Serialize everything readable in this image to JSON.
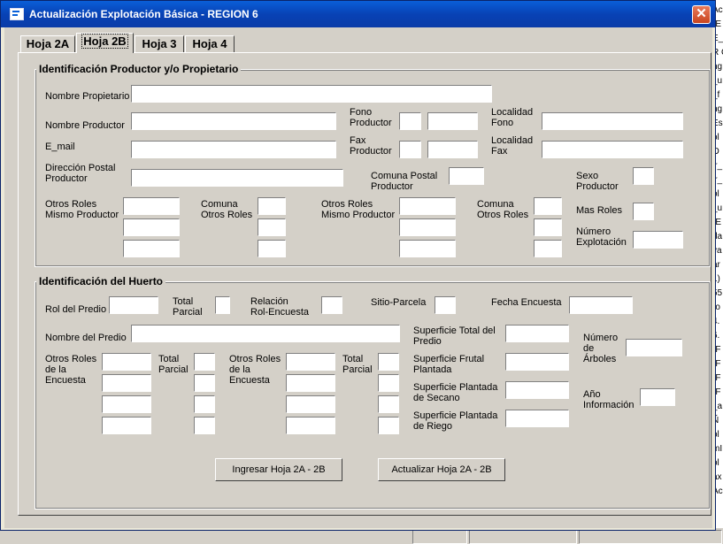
{
  "window": {
    "title": "Actualización Explotación Básica - REGION 6",
    "close": "✕"
  },
  "tabs": [
    "Hoja 2A",
    "Hoja 2B",
    "Hoja 3",
    "Hoja 4"
  ],
  "group1": {
    "title": "Identificación Productor y/o Propietario",
    "labels": {
      "nombre_propietario": "Nombre Propietario",
      "nombre_productor": "Nombre Productor",
      "fono_productor": "Fono\nProductor",
      "localidad_fono": "Localidad\nFono",
      "email": "E_mail",
      "fax_productor": "Fax\nProductor",
      "localidad_fax": "Localidad\nFax",
      "direccion_postal": "Dirección Postal\nProductor",
      "comuna_postal": "Comuna Postal\nProductor",
      "sexo_productor": "Sexo\nProductor",
      "otros_roles_1": "Otros Roles\nMismo Productor",
      "comuna_otros_1": "Comuna\nOtros Roles",
      "otros_roles_2": "Otros Roles\nMismo Productor",
      "comuna_otros_2": "Comuna\nOtros Roles",
      "mas_roles": "Mas Roles",
      "numero_explotacion": "Número\nExplotación"
    }
  },
  "group2": {
    "title": "Identificación del Huerto",
    "labels": {
      "rol_predio": "Rol del Predio",
      "total_parcial_1": "Total\nParcial",
      "relacion_rol": "Relación\nRol-Encuesta",
      "sitio_parcela": "Sitio-Parcela",
      "fecha_encuesta": "Fecha Encuesta",
      "nombre_predio": "Nombre del Predio",
      "superficie_total": "Superficie Total del\nPredio",
      "numero_arboles": "Número\nde\nÁrboles",
      "otros_roles_a": "Otros Roles\nde  la\nEncuesta",
      "total_parcial_a": "Total\nParcial",
      "otros_roles_b": "Otros Roles\nde la\nEncuesta",
      "total_parcial_b": "Total\nParcial",
      "superficie_frutal": "Superficie Frutal\nPlantada",
      "superficie_secano": "Superficie Plantada\nde Secano",
      "superficie_riego": "Superficie Plantada\nde Riego",
      "ano_informacion": "Año\nInformación"
    }
  },
  "buttons": {
    "ingresar": "Ingresar Hoja 2A - 2B",
    "actualizar": "Actualizar Hoja 2A - 2B"
  },
  "background_text": [
    "Ac",
    "(E",
    "E_",
    "R C",
    "ng",
    "_u",
    "_f",
    "ng",
    "Es",
    "ol",
    "O",
    "ir_",
    "ir_",
    "ol",
    "_u",
    "(E",
    "da",
    "va",
    "ar",
    "1)",
    "55",
    "ro",
    "4.",
    "6.",
    "(F",
    "(F",
    "(F",
    "(F",
    "_a",
    "Ñ",
    "ol",
    "mI",
    "ol",
    "ax",
    "Ac"
  ],
  "colors": {
    "titlebar": "#0842b5",
    "face": "#d4d0c8",
    "close": "#c9451f"
  }
}
